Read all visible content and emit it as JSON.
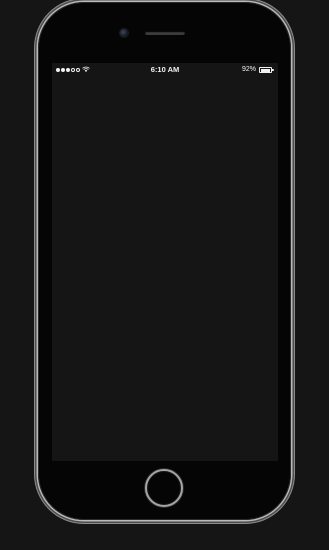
{
  "device": {
    "model_color": "space-gray"
  },
  "status_bar": {
    "signal_dots_filled": 3,
    "signal_dots_total": 5,
    "wifi_icon": "wifi-icon",
    "time": "6:10 AM",
    "battery_text": "92%",
    "battery_level": 0.92
  },
  "screen": {
    "background": "#151515"
  },
  "colors": {
    "background": "#151515",
    "bezel": "#050505",
    "frame": "#b9b9b9",
    "status_text": "#f2f2f2"
  }
}
